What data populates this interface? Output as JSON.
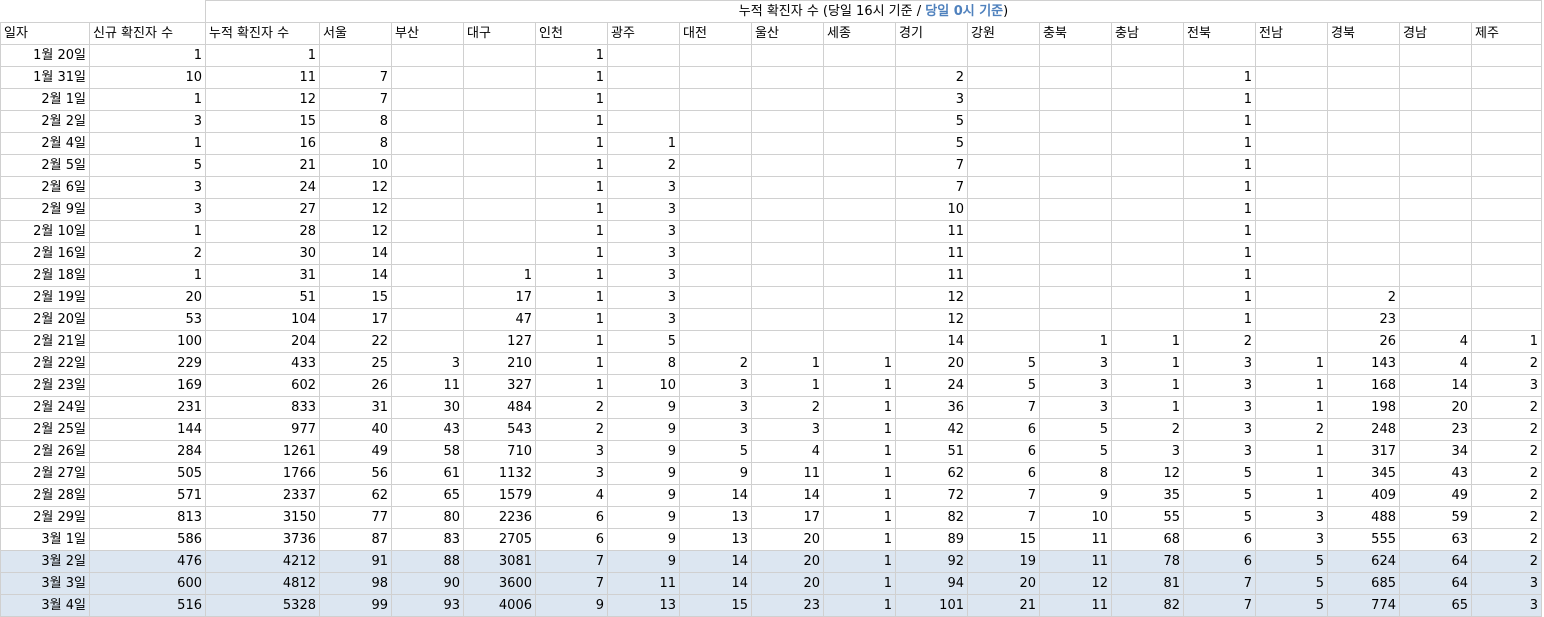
{
  "title_main": "누적 확진자 수 (당일 16시 기준 / ",
  "title_blue": "당일 0시 기준",
  "title_end": ")",
  "highlight_color": "#dce6f1",
  "headers": [
    "일자",
    "신규 확진자 수",
    "누적 확진자 수",
    "서울",
    "부산",
    "대구",
    "인천",
    "광주",
    "대전",
    "울산",
    "세종",
    "경기",
    "강원",
    "충북",
    "충남",
    "전북",
    "전남",
    "경북",
    "경남",
    "제주"
  ],
  "rows": [
    {
      "date": "1월 20일",
      "cells": [
        "1",
        "1",
        "",
        "",
        "",
        "1",
        "",
        "",
        "",
        "",
        "",
        "",
        "",
        "",
        "",
        "",
        "",
        "",
        ""
      ],
      "hl": false
    },
    {
      "date": "1월 31일",
      "cells": [
        "10",
        "11",
        "7",
        "",
        "",
        "1",
        "",
        "",
        "",
        "",
        "2",
        "",
        "",
        "",
        "1",
        "",
        "",
        "",
        ""
      ],
      "hl": false
    },
    {
      "date": "2월 1일",
      "cells": [
        "1",
        "12",
        "7",
        "",
        "",
        "1",
        "",
        "",
        "",
        "",
        "3",
        "",
        "",
        "",
        "1",
        "",
        "",
        "",
        ""
      ],
      "hl": false
    },
    {
      "date": "2월 2일",
      "cells": [
        "3",
        "15",
        "8",
        "",
        "",
        "1",
        "",
        "",
        "",
        "",
        "5",
        "",
        "",
        "",
        "1",
        "",
        "",
        "",
        ""
      ],
      "hl": false
    },
    {
      "date": "2월 4일",
      "cells": [
        "1",
        "16",
        "8",
        "",
        "",
        "1",
        "1",
        "",
        "",
        "",
        "5",
        "",
        "",
        "",
        "1",
        "",
        "",
        "",
        ""
      ],
      "hl": false
    },
    {
      "date": "2월 5일",
      "cells": [
        "5",
        "21",
        "10",
        "",
        "",
        "1",
        "2",
        "",
        "",
        "",
        "7",
        "",
        "",
        "",
        "1",
        "",
        "",
        "",
        ""
      ],
      "hl": false
    },
    {
      "date": "2월 6일",
      "cells": [
        "3",
        "24",
        "12",
        "",
        "",
        "1",
        "3",
        "",
        "",
        "",
        "7",
        "",
        "",
        "",
        "1",
        "",
        "",
        "",
        ""
      ],
      "hl": false
    },
    {
      "date": "2월 9일",
      "cells": [
        "3",
        "27",
        "12",
        "",
        "",
        "1",
        "3",
        "",
        "",
        "",
        "10",
        "",
        "",
        "",
        "1",
        "",
        "",
        "",
        ""
      ],
      "hl": false
    },
    {
      "date": "2월 10일",
      "cells": [
        "1",
        "28",
        "12",
        "",
        "",
        "1",
        "3",
        "",
        "",
        "",
        "11",
        "",
        "",
        "",
        "1",
        "",
        "",
        "",
        ""
      ],
      "hl": false
    },
    {
      "date": "2월 16일",
      "cells": [
        "2",
        "30",
        "14",
        "",
        "",
        "1",
        "3",
        "",
        "",
        "",
        "11",
        "",
        "",
        "",
        "1",
        "",
        "",
        "",
        ""
      ],
      "hl": false
    },
    {
      "date": "2월 18일",
      "cells": [
        "1",
        "31",
        "14",
        "",
        "1",
        "1",
        "3",
        "",
        "",
        "",
        "11",
        "",
        "",
        "",
        "1",
        "",
        "",
        "",
        ""
      ],
      "hl": false
    },
    {
      "date": "2월 19일",
      "cells": [
        "20",
        "51",
        "15",
        "",
        "17",
        "1",
        "3",
        "",
        "",
        "",
        "12",
        "",
        "",
        "",
        "1",
        "",
        "2",
        "",
        ""
      ],
      "hl": false
    },
    {
      "date": "2월 20일",
      "cells": [
        "53",
        "104",
        "17",
        "",
        "47",
        "1",
        "3",
        "",
        "",
        "",
        "12",
        "",
        "",
        "",
        "1",
        "",
        "23",
        "",
        ""
      ],
      "hl": false
    },
    {
      "date": "2월 21일",
      "cells": [
        "100",
        "204",
        "22",
        "",
        "127",
        "1",
        "5",
        "",
        "",
        "",
        "14",
        "",
        "1",
        "1",
        "2",
        "",
        "26",
        "4",
        "1"
      ],
      "hl": false
    },
    {
      "date": "2월 22일",
      "cells": [
        "229",
        "433",
        "25",
        "3",
        "210",
        "1",
        "8",
        "2",
        "1",
        "1",
        "20",
        "5",
        "3",
        "1",
        "3",
        "1",
        "143",
        "4",
        "2"
      ],
      "hl": false
    },
    {
      "date": "2월 23일",
      "cells": [
        "169",
        "602",
        "26",
        "11",
        "327",
        "1",
        "10",
        "3",
        "1",
        "1",
        "24",
        "5",
        "3",
        "1",
        "3",
        "1",
        "168",
        "14",
        "3"
      ],
      "hl": false
    },
    {
      "date": "2월 24일",
      "cells": [
        "231",
        "833",
        "31",
        "30",
        "484",
        "2",
        "9",
        "3",
        "2",
        "1",
        "36",
        "7",
        "3",
        "1",
        "3",
        "1",
        "198",
        "20",
        "2"
      ],
      "hl": false
    },
    {
      "date": "2월 25일",
      "cells": [
        "144",
        "977",
        "40",
        "43",
        "543",
        "2",
        "9",
        "3",
        "3",
        "1",
        "42",
        "6",
        "5",
        "2",
        "3",
        "2",
        "248",
        "23",
        "2"
      ],
      "hl": false
    },
    {
      "date": "2월 26일",
      "cells": [
        "284",
        "1261",
        "49",
        "58",
        "710",
        "3",
        "9",
        "5",
        "4",
        "1",
        "51",
        "6",
        "5",
        "3",
        "3",
        "1",
        "317",
        "34",
        "2"
      ],
      "hl": false
    },
    {
      "date": "2월 27일",
      "cells": [
        "505",
        "1766",
        "56",
        "61",
        "1132",
        "3",
        "9",
        "9",
        "11",
        "1",
        "62",
        "6",
        "8",
        "12",
        "5",
        "1",
        "345",
        "43",
        "2"
      ],
      "hl": false
    },
    {
      "date": "2월 28일",
      "cells": [
        "571",
        "2337",
        "62",
        "65",
        "1579",
        "4",
        "9",
        "14",
        "14",
        "1",
        "72",
        "7",
        "9",
        "35",
        "5",
        "1",
        "409",
        "49",
        "2"
      ],
      "hl": false
    },
    {
      "date": "2월 29일",
      "cells": [
        "813",
        "3150",
        "77",
        "80",
        "2236",
        "6",
        "9",
        "13",
        "17",
        "1",
        "82",
        "7",
        "10",
        "55",
        "5",
        "3",
        "488",
        "59",
        "2"
      ],
      "hl": false
    },
    {
      "date": "3월 1일",
      "cells": [
        "586",
        "3736",
        "87",
        "83",
        "2705",
        "6",
        "9",
        "13",
        "20",
        "1",
        "89",
        "15",
        "11",
        "68",
        "6",
        "3",
        "555",
        "63",
        "2"
      ],
      "hl": false
    },
    {
      "date": "3월 2일",
      "cells": [
        "476",
        "4212",
        "91",
        "88",
        "3081",
        "7",
        "9",
        "14",
        "20",
        "1",
        "92",
        "19",
        "11",
        "78",
        "6",
        "5",
        "624",
        "64",
        "2"
      ],
      "hl": true
    },
    {
      "date": "3월 3일",
      "cells": [
        "600",
        "4812",
        "98",
        "90",
        "3600",
        "7",
        "11",
        "14",
        "20",
        "1",
        "94",
        "20",
        "12",
        "81",
        "7",
        "5",
        "685",
        "64",
        "3"
      ],
      "hl": true
    },
    {
      "date": "3월 4일",
      "cells": [
        "516",
        "5328",
        "99",
        "93",
        "4006",
        "9",
        "13",
        "15",
        "23",
        "1",
        "101",
        "21",
        "11",
        "82",
        "7",
        "5",
        "774",
        "65",
        "3"
      ],
      "hl": true
    }
  ]
}
